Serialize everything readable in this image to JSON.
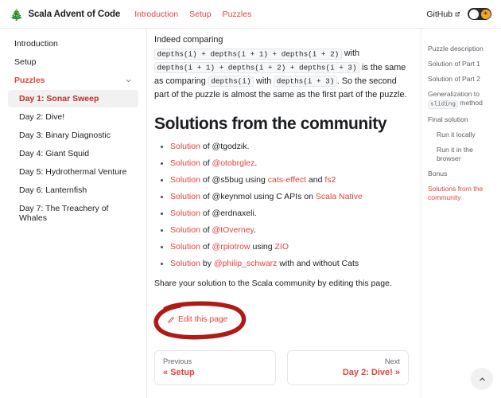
{
  "navbar": {
    "logo_icon": "christmas-tree-icon",
    "logo_glyph": "🎄",
    "title": "Scala Advent of Code",
    "links": [
      {
        "label": "Introduction"
      },
      {
        "label": "Setup"
      },
      {
        "label": "Puzzles"
      }
    ],
    "github_label": "GitHub",
    "external_icon": "external-link-icon",
    "theme_toggle": {
      "icon": "sun-icon",
      "glyph": "☀",
      "state": "dark",
      "track_color": "#2b2b2b",
      "sun_color": "#f5a623"
    }
  },
  "sidebar": {
    "items": [
      {
        "label": "Introduction",
        "state": "normal"
      },
      {
        "label": "Setup",
        "state": "normal"
      },
      {
        "label": "Puzzles",
        "state": "accent",
        "icon": "chevron-down-icon"
      },
      {
        "label": "Day 1: Sonar Sweep",
        "state": "active"
      },
      {
        "label": "Day 2: Dive!",
        "state": "sub"
      },
      {
        "label": "Day 3: Binary Diagnostic",
        "state": "sub"
      },
      {
        "label": "Day 4: Giant Squid",
        "state": "sub"
      },
      {
        "label": "Day 5: Hydrothermal Venture",
        "state": "sub"
      },
      {
        "label": "Day 6: Lanternfish",
        "state": "sub"
      },
      {
        "label": "Day 7: The Treachery of Whales",
        "state": "sub"
      }
    ]
  },
  "main": {
    "paragraph": {
      "t1": "Indeed comparing ",
      "c1": "depths(i) + depths(i + 1) + depths(i + 2)",
      "t2": " with ",
      "c2": "depths(i + 1) + depths(i + 2) + depths(i + 3)",
      "t3": " is the same as comparing ",
      "c3": "depths(i)",
      "t4": " with ",
      "c4": "depths(i + 3)",
      "t5": ". So the second part of the puzzle is almost the same as the first part of the puzzle."
    },
    "heading": "Solutions from the community",
    "solutions": [
      {
        "link": "Solution",
        "mid": " of ",
        "author": "@tgodzik",
        "author_link": false,
        "tail": "."
      },
      {
        "link": "Solution",
        "mid": " of ",
        "author": "@otobrglez",
        "author_link": true,
        "tail": "."
      },
      {
        "link": "Solution",
        "mid": " of @s5bug using ",
        "author": "cats-effect",
        "author_link": true,
        "tail": " and ",
        "extra": "fs2",
        "extra_link": true
      },
      {
        "link": "Solution",
        "mid": " of @keynmol using C APIs on ",
        "author": "Scala Native",
        "author_link": true,
        "tail": ""
      },
      {
        "link": "Solution",
        "mid": " of ",
        "author": "@erdnaxeli",
        "author_link": false,
        "tail": "."
      },
      {
        "link": "Solution",
        "mid": " of ",
        "author": "@tOverney",
        "author_link": true,
        "tail": "."
      },
      {
        "link": "Solution",
        "mid": " of ",
        "author": "@rpiotrow",
        "author_link": true,
        "tail": " using ",
        "extra": "ZIO",
        "extra_link": true
      },
      {
        "link": "Solution",
        "mid": " by ",
        "author": "@philip_schwarz",
        "author_link": true,
        "tail": " with and without Cats"
      }
    ],
    "share_text": "Share your solution to the Scala community by editing this page.",
    "edit_link": "Edit this page",
    "edit_icon": "pencil-icon",
    "annotation": {
      "shape": "hand-drawn-ellipse",
      "color": "#b01a16"
    },
    "pager": {
      "previous_label": "Previous",
      "previous_title": "« Setup",
      "next_label": "Next",
      "next_title": "Day 2: Dive! »"
    }
  },
  "toc": {
    "items": [
      {
        "label": "Puzzle description",
        "indent": false,
        "active": false
      },
      {
        "label": "Solution of Part 1",
        "indent": false,
        "active": false
      },
      {
        "label": "Solution of Part 2",
        "indent": false,
        "active": false
      },
      {
        "label": "Generalization to",
        "code": "sliding",
        "label2": " method",
        "indent": false,
        "active": false
      },
      {
        "label": "Final solution",
        "indent": false,
        "active": false
      },
      {
        "label": "Run it locally",
        "indent": true,
        "active": false
      },
      {
        "label": "Run it in the browser",
        "indent": true,
        "active": false
      },
      {
        "label": "Bonus",
        "indent": false,
        "active": false
      },
      {
        "label": "Solutions from the community",
        "indent": false,
        "active": true
      }
    ]
  },
  "scroll_top": {
    "icon": "chevron-up-icon"
  },
  "colors": {
    "accent": "#e0443e",
    "accent_dark": "#c22d26",
    "text": "#1c1e21",
    "muted": "#5c6066",
    "annotation": "#b01a16"
  }
}
